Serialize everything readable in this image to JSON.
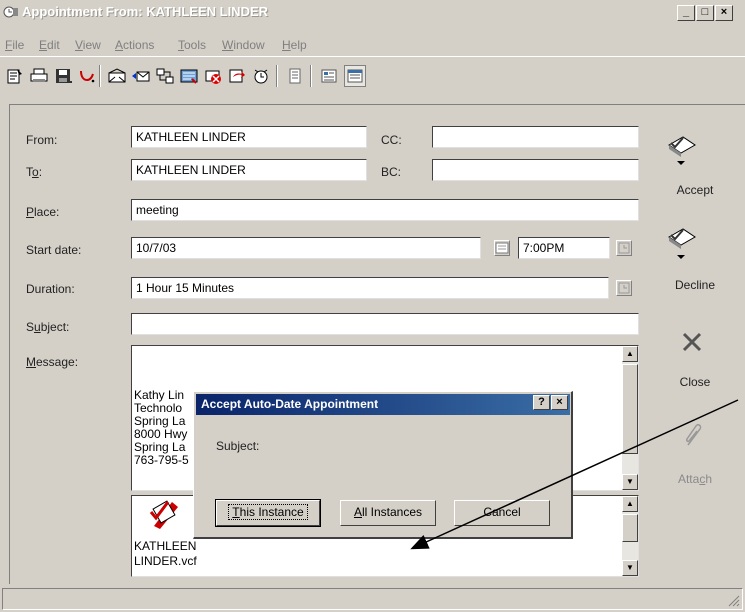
{
  "window": {
    "title": "Appointment From: KATHLEEN LINDER",
    "controls": [
      "_",
      "□",
      "×"
    ]
  },
  "menu": [
    {
      "pre": "",
      "key": "F",
      "post": "ile"
    },
    {
      "pre": "",
      "key": "E",
      "post": "dit"
    },
    {
      "pre": "",
      "key": "V",
      "post": "iew"
    },
    {
      "pre": "",
      "key": "A",
      "post": "ctions"
    },
    {
      "pre": "",
      "key": "T",
      "post": "ools"
    },
    {
      "pre": "",
      "key": "W",
      "post": "indow"
    },
    {
      "pre": "",
      "key": "H",
      "post": "elp"
    }
  ],
  "form": {
    "from_label": "From:",
    "from_value": "KATHLEEN LINDER",
    "to_label_pre": "T",
    "to_label_key": "o",
    "to_label_post": ":",
    "to_value": "KATHLEEN LINDER",
    "cc_label": "CC:",
    "cc_value": "",
    "bc_label": "BC:",
    "bc_value": "",
    "place_label_key": "P",
    "place_label_post": "lace:",
    "place_value": "meeting",
    "start_label": "Start date:",
    "start_value": "10/7/03",
    "time_value": "7:00PM",
    "duration_label": "Duration:",
    "duration_value": "1 Hour 15 Minutes",
    "subject_label_pre": "S",
    "subject_label_key": "u",
    "subject_label_post": "bject:",
    "subject_value": "",
    "message_label_key": "M",
    "message_label_post": "essage:",
    "message_lines": [
      "Kathy Lin",
      "Technolo",
      "Spring La",
      "8000 Hwy",
      "Spring La",
      "763-795-5"
    ],
    "attachment_name_1": "KATHLEEN",
    "attachment_name_2": "LINDER.vcf"
  },
  "actions": {
    "accept": "Accept",
    "decline": "Decline",
    "close": "Close",
    "attach_pre": "Atta",
    "attach_key": "c",
    "attach_post": "h"
  },
  "dialog": {
    "title": "Accept Auto-Date Appointment",
    "subject_label": "Subject:",
    "help_btn": "?",
    "close_btn": "×",
    "btn_this_pre": "",
    "btn_this_key": "T",
    "btn_this_post": "his Instance",
    "btn_all_pre": "",
    "btn_all_key": "A",
    "btn_all_post": "ll Instances",
    "btn_cancel": "Cancel"
  },
  "colors": {
    "face": "#d4d0c8",
    "dialog_title": "#0a246a",
    "arrow": "#000000"
  },
  "icons": [
    "appointment-icon",
    "properties-icon",
    "print-icon",
    "save-icon",
    "attach-icon",
    "open-envelope-icon",
    "reply-icon",
    "schedule-icon",
    "card-icon",
    "delete-icon",
    "forward-icon",
    "alarm-icon",
    "notes-icon",
    "list-icon",
    "calendar-icon"
  ]
}
